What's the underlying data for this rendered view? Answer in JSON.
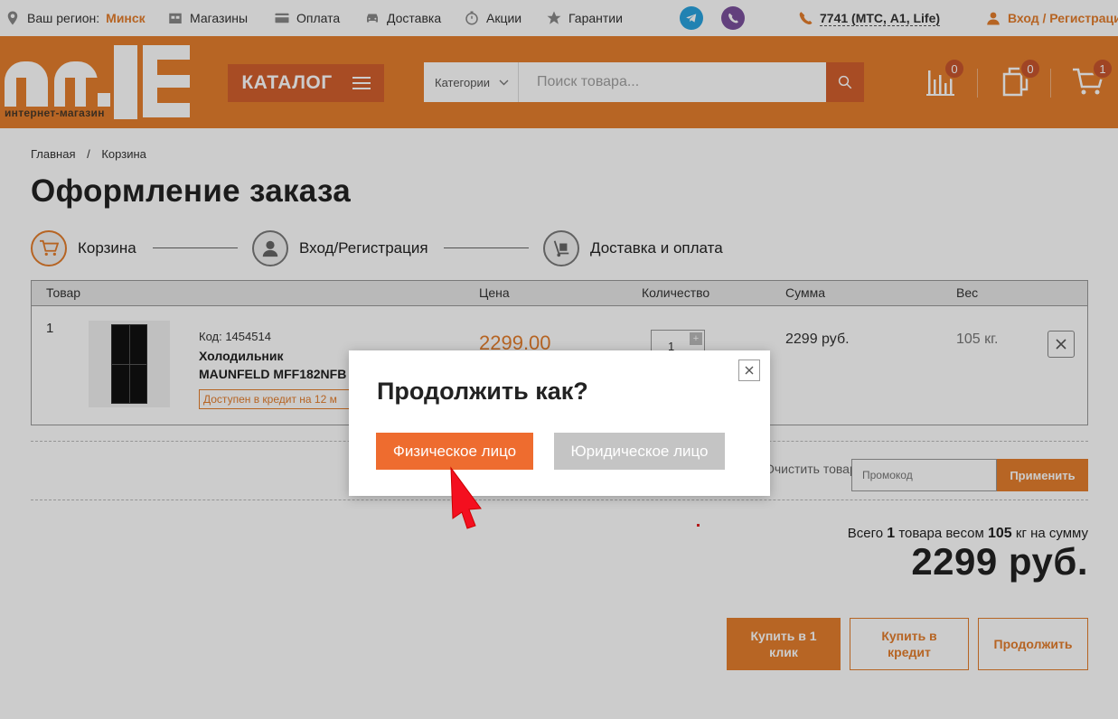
{
  "topbar": {
    "region_label": "Ваш регион:",
    "region_city": "Минск",
    "nav": [
      "Магазины",
      "Оплата",
      "Доставка",
      "Акции",
      "Гарантии"
    ],
    "phone": "7741 (МТС, А1, Life)",
    "login": "Вход / Регистрация",
    "colors": {
      "telegram": "#2aa3df",
      "viber": "#7b519d"
    }
  },
  "header": {
    "logo_text": "mIlE",
    "logo_sub": "интернет-магазин",
    "catalog_label": "КАТАЛОГ",
    "search_category": "Категории",
    "search_placeholder": "Поиск товара...",
    "compare_count": "0",
    "favorites_count": "0",
    "cart_count": "1",
    "brand_color": "#e57f2d"
  },
  "breadcrumb": {
    "home": "Главная",
    "sep": "/",
    "current": "Корзина"
  },
  "page_title": "Оформление заказа",
  "steps": [
    "Корзина",
    "Вход/Регистрация",
    "Доставка и оплата"
  ],
  "table": {
    "headers": {
      "product": "Товар",
      "price": "Цена",
      "qty": "Количество",
      "sum": "Сумма",
      "weight": "Вес"
    },
    "row": {
      "num": "1",
      "code": "Код: 1454514",
      "name": "Холодильник MAUNFELD MFF182NFB",
      "credit": "Доступен в кредит на 12 м",
      "price": "2299.00",
      "qty": "1",
      "qty_plus": "+",
      "sum": "2299 руб.",
      "weight": "105 кг."
    }
  },
  "cart": {
    "clear_label": "Очистить товары",
    "promo_placeholder": "Промокод",
    "promo_apply": "Применить",
    "total_prefix": "Всего",
    "total_count": "1",
    "total_mid1": "товара весом",
    "total_weight": "105",
    "total_mid2": "кг на сумму",
    "total_sum": "2299 руб.",
    "btn_oneclick": "Купить в 1 клик",
    "btn_credit": "Купить в кредит",
    "btn_continue": "Продолжить"
  },
  "modal": {
    "title": "Продолжить как?",
    "btn_physical": "Физическое лицо",
    "btn_legal": "Юридическое лицо",
    "close": "×"
  }
}
